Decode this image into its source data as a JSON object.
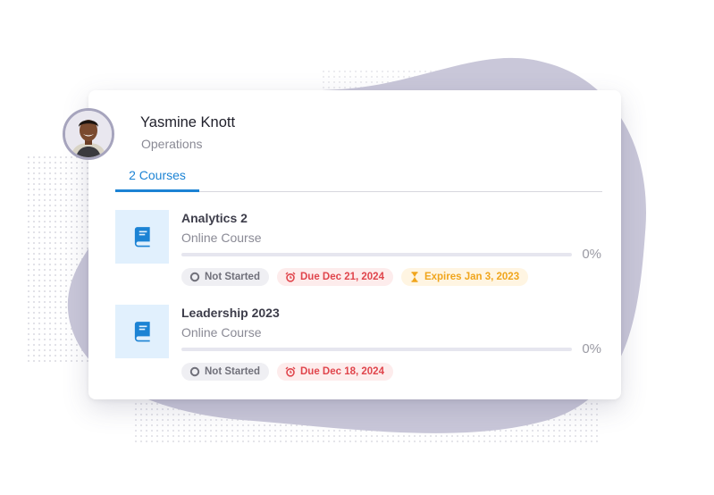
{
  "profile": {
    "name": "Yasmine Knott",
    "department": "Operations"
  },
  "tabs": [
    {
      "label": "2 Courses",
      "active": true
    }
  ],
  "courses": [
    {
      "title": "Analytics 2",
      "type": "Online Course",
      "progress_percent": 0,
      "progress_label": "0%",
      "icon": "book-icon",
      "badges": {
        "status": "Not Started",
        "due": "Due Dec 21, 2024",
        "expires": "Expires Jan 3, 2023"
      }
    },
    {
      "title": "Leadership 2023",
      "type": "Online Course",
      "progress_percent": 0,
      "progress_label": "0%",
      "icon": "book-icon",
      "badges": {
        "status": "Not Started",
        "due": "Due Dec 18, 2024"
      }
    }
  ],
  "colors": {
    "accent": "#1c83d4",
    "blob": "#c9c7d9",
    "status_grey": "#70707a",
    "due_red": "#e0454c",
    "expires_amber": "#f0a51c"
  }
}
